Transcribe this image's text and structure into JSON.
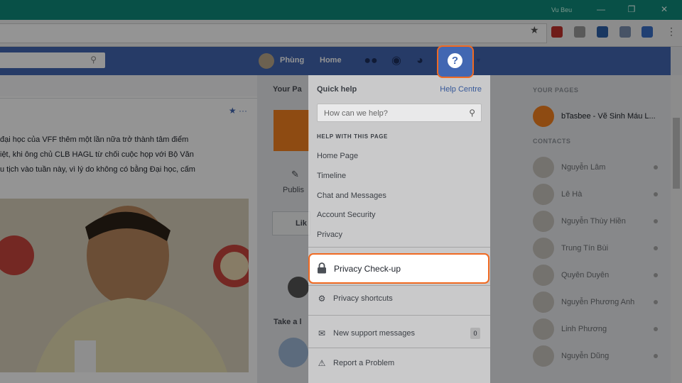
{
  "window": {
    "user": "Vu Beu",
    "minimize": "—",
    "restore": "❐",
    "close": "✕"
  },
  "browser": {
    "star": "★",
    "more": "⋮"
  },
  "fbnav": {
    "profile_name": "Phùng",
    "home": "Home"
  },
  "feed": {
    "post_text": [
      "đại học của VFF thêm một lần nữa trở thành tâm điểm",
      "iệt, khi ông chủ CLB HAGL từ chối cuộc họp với Bộ Văn",
      "u tịch vào tuần này, vì lý do không có bằng Đại học, cấm"
    ],
    "post_menu": "★ ···"
  },
  "middle": {
    "header": "Your Pa",
    "publish": "Publis",
    "like": "Lik",
    "take": "Take a l"
  },
  "help": {
    "title": "Quick help",
    "centre": "Help Centre",
    "search_placeholder": "How can we help?",
    "section": "HELP WITH THIS PAGE",
    "links": [
      "Home Page",
      "Timeline",
      "Chat and Messages",
      "Account Security",
      "Privacy"
    ],
    "privacy_checkup": "Privacy Check-up",
    "privacy_shortcuts": "Privacy shortcuts",
    "support_messages": "New support messages",
    "support_count": "0",
    "report": "Report a Problem"
  },
  "sidebar": {
    "your_pages": "YOUR PAGES",
    "page_name": "bTasbee - Vẽ Sinh Máu L...",
    "contacts_label": "CONTACTS",
    "contacts": [
      "Nguyễn Lâm",
      "Lê Hà",
      "Nguyễn Thùy Hiền",
      "Trung Tín Bùi",
      "Quyên Duyên",
      "Nguyễn Phương Anh",
      "Linh Phương",
      "Nguyễn Dũng"
    ]
  }
}
